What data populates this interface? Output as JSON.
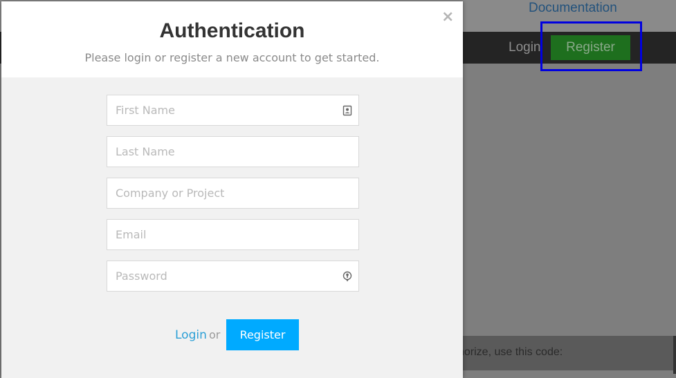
{
  "background_page": {
    "top_link": "Documentation",
    "nav": {
      "login_label": "Login",
      "register_label": "Register"
    },
    "code_banner_text": "horize, use this code:"
  },
  "modal": {
    "close_symbol": "×",
    "title": "Authentication",
    "subtitle": "Please login or register a new account to get started.",
    "fields": {
      "first_name": {
        "placeholder": "First Name",
        "value": "",
        "icon": "contact-card-icon"
      },
      "last_name": {
        "placeholder": "Last Name",
        "value": ""
      },
      "company": {
        "placeholder": "Company or Project",
        "value": ""
      },
      "email": {
        "placeholder": "Email",
        "value": ""
      },
      "password": {
        "placeholder": "Password",
        "value": "",
        "icon": "password-key-icon"
      }
    },
    "footer": {
      "login_label": "Login",
      "or_text": "or",
      "register_label": "Register"
    }
  },
  "colors": {
    "overlay_gray": "#7e7e7e",
    "navbar_dark": "#242424",
    "nav_register_green": "#1e6f1e",
    "highlight_blue": "#0000e0",
    "primary_button": "#00aaff",
    "link_blue": "#2a9fd6"
  }
}
